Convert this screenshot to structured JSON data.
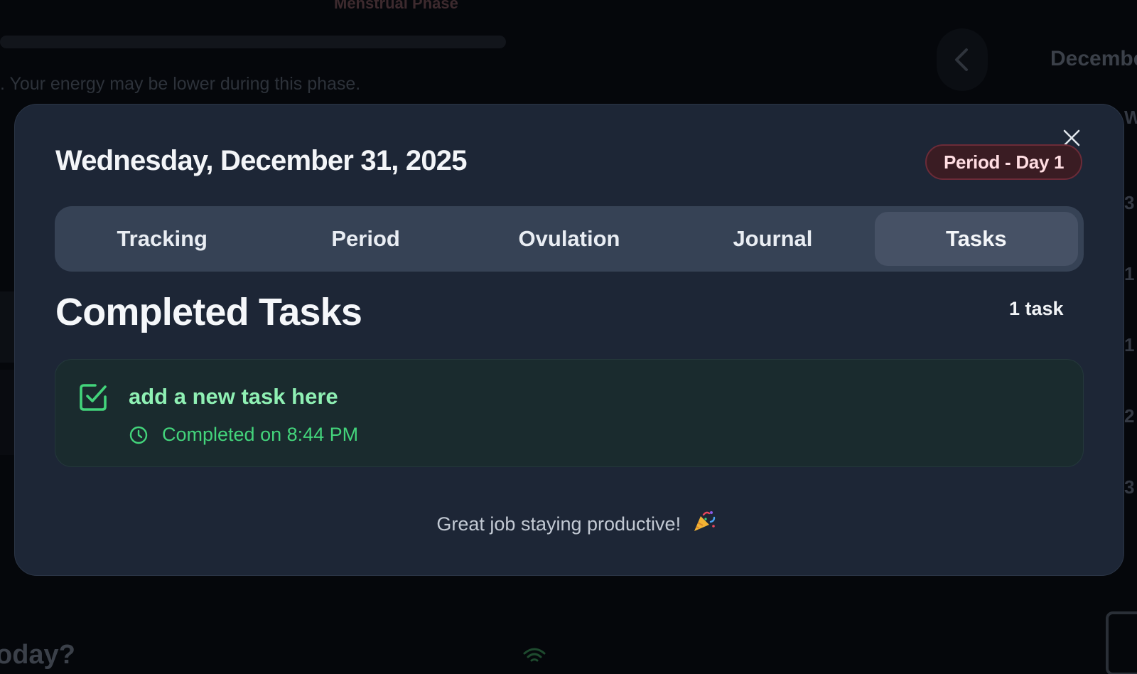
{
  "background": {
    "phase_title": "Menstrual Phase",
    "phase_desc": ". Your energy may be lower during this phase.",
    "month": "December",
    "today_prompt": "oday?",
    "side_numbers": [
      "W",
      "3",
      "1",
      "1",
      "2",
      "3"
    ]
  },
  "modal": {
    "date": "Wednesday, December 31, 2025",
    "badge": "Period - Day 1",
    "tabs": [
      {
        "label": "Tracking",
        "active": false
      },
      {
        "label": "Period",
        "active": false
      },
      {
        "label": "Ovulation",
        "active": false
      },
      {
        "label": "Journal",
        "active": false
      },
      {
        "label": "Tasks",
        "active": true
      }
    ],
    "section_title": "Completed Tasks",
    "task_count": "1 task",
    "tasks": [
      {
        "title": "add a new task here",
        "completed_text": "Completed on 8:44 PM",
        "icon": "check-square-icon"
      }
    ],
    "footer": "Great job staying productive!",
    "footer_emoji": "party-popper-icon"
  },
  "colors": {
    "modal_bg": "#1d2636",
    "tab_bar_bg": "#364255",
    "tab_active_bg": "#465165",
    "badge_bg": "#3a1c23",
    "badge_border": "#6b2b38",
    "task_card_bg": "#1a2b2e",
    "task_title": "#8ff0b4",
    "task_meta": "#43d47b"
  }
}
